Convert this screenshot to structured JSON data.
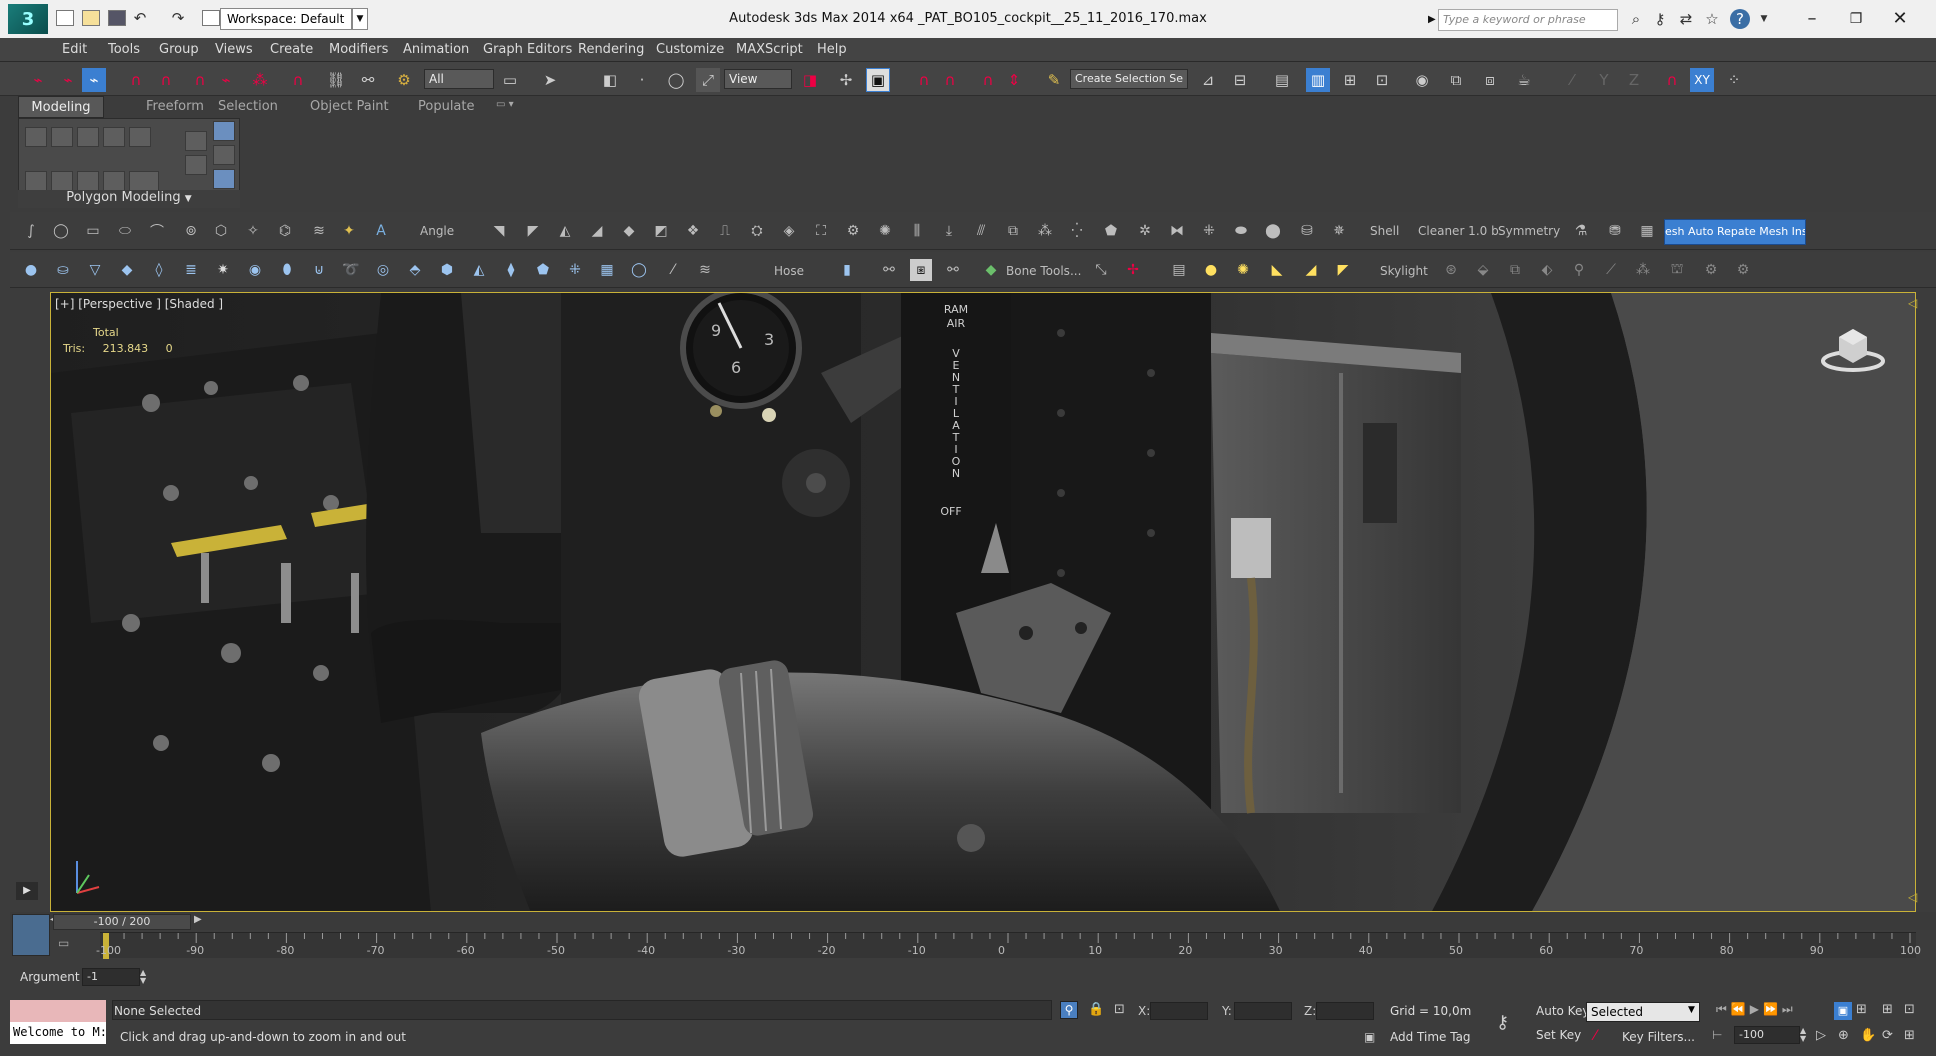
{
  "app": {
    "window_title": "Autodesk 3ds Max  2014 x64      _PAT_BO105_cockpit__25_11_2016_170.max",
    "workspace": "Workspace: Default",
    "search_placeholder": "Type a keyword or phrase"
  },
  "menu": [
    "Edit",
    "Tools",
    "Group",
    "Views",
    "Create",
    "Modifiers",
    "Animation",
    "Graph Editors",
    "Rendering",
    "Customize",
    "MAXScript",
    "Help"
  ],
  "main_toolbar": {
    "filter": "All",
    "view_dropdown": "View",
    "selection_set": "Create Selection Se"
  },
  "ribbon": {
    "tabs": [
      "Modeling",
      "Freeform",
      "Selection",
      "Object Paint",
      "Populate"
    ],
    "active_tab": "Modeling",
    "panel_label": "Polygon Modeling"
  },
  "shelf1": {
    "angle_label": "Angle",
    "shell_label": "Shell",
    "cleaner_label": "Cleaner 1.0 b",
    "symmetry_label": "Symmetry",
    "mesh_button": "esh Auto Repate Mesh Insp"
  },
  "shelf2": {
    "hose_label": "Hose",
    "bone_tools_label": "Bone Tools...",
    "skylight_label": "Skylight"
  },
  "viewport": {
    "label": "[+] [Perspective ] [Shaded ]",
    "stats_total": "Total",
    "stats_tris_label": "Tris:",
    "stats_tris_value": "213.843",
    "stats_tris_sel": "0",
    "placard_text": [
      "RAM",
      "AIR",
      "V",
      "E",
      "N",
      "T",
      "I",
      "L",
      "A",
      "T",
      "I",
      "O",
      "N",
      "OFF"
    ]
  },
  "timeline": {
    "position": "-100 / 200",
    "ticks": [
      "-100",
      "-90",
      "-80",
      "-70",
      "-60",
      "-50",
      "-40",
      "-30",
      "-20",
      "-10",
      "0",
      "10",
      "20",
      "30",
      "40",
      "50",
      "60",
      "70",
      "80",
      "90",
      "100"
    ],
    "current_frame_fraction": 0
  },
  "bottom": {
    "argument_label": "Argument",
    "argument_value": "-1",
    "welcome": "Welcome to M:",
    "selection_status": "None Selected",
    "prompt": "Click and drag up-and-down to zoom in and out",
    "x_label": "X:",
    "y_label": "Y:",
    "z_label": "Z:",
    "grid": "Grid = 10,0m",
    "add_time_tag": "Add Time Tag",
    "auto_key": "Auto Key",
    "set_key": "Set Key",
    "key_mode": "Selected",
    "key_filters": "Key Filters...",
    "frame_value": "-100"
  },
  "colors": {
    "accent_blue": "#3b7fd1",
    "viewport_border": "#c9b238",
    "icon_red": "#e0003c"
  }
}
